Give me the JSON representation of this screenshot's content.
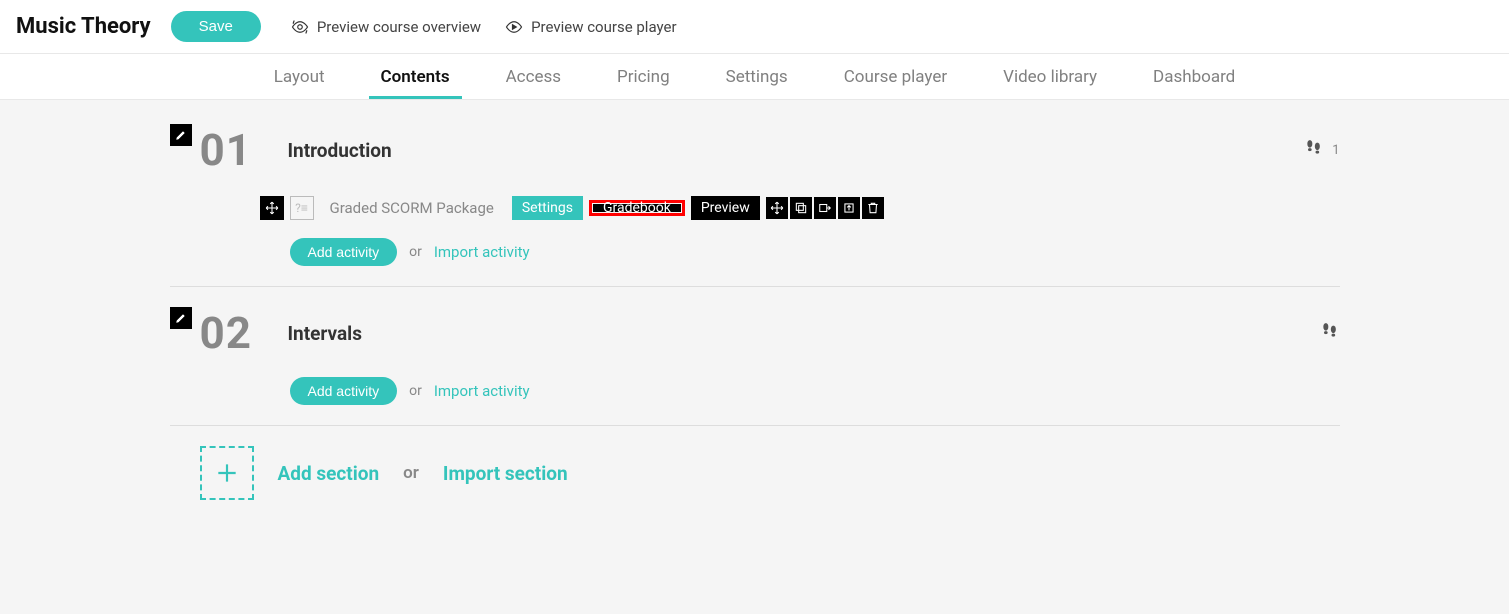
{
  "header": {
    "course_title": "Music Theory",
    "save": "Save",
    "preview_overview": "Preview course overview",
    "preview_player": "Preview course player"
  },
  "tabs": {
    "layout": "Layout",
    "contents": "Contents",
    "access": "Access",
    "pricing": "Pricing",
    "settings": "Settings",
    "course_player": "Course player",
    "video_library": "Video library",
    "dashboard": "Dashboard"
  },
  "sections": [
    {
      "num": "01",
      "title": "Introduction",
      "steps_count": "1",
      "activity": {
        "title": "Graded SCORM Package",
        "settings": "Settings",
        "gradebook": "Gradebook",
        "preview": "Preview"
      }
    },
    {
      "num": "02",
      "title": "Intervals"
    }
  ],
  "actions": {
    "add_activity": "Add activity",
    "import_activity": "Import activity",
    "or": "or",
    "add_section": "Add section",
    "import_section": "Import section"
  }
}
